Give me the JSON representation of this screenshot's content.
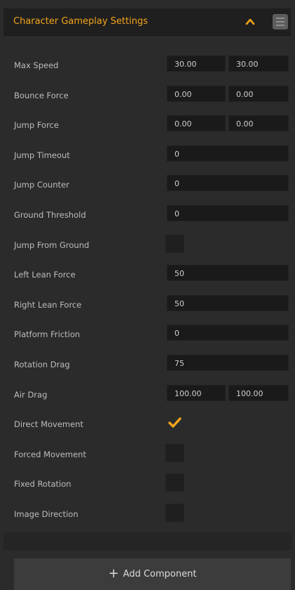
{
  "header": {
    "title": "Character Gameplay Settings",
    "collapse_icon": "chevron-up-icon",
    "menu_icon": "menu-icon",
    "accent": "#f3a51b"
  },
  "rows": [
    {
      "id": "max-speed",
      "label": "Max Speed",
      "type": "vec2",
      "values": [
        "30.00",
        "30.00"
      ]
    },
    {
      "id": "bounce-force",
      "label": "Bounce Force",
      "type": "vec2",
      "values": [
        "0.00",
        "0.00"
      ]
    },
    {
      "id": "jump-force",
      "label": "Jump Force",
      "type": "vec2",
      "values": [
        "0.00",
        "0.00"
      ]
    },
    {
      "id": "jump-timeout",
      "label": "Jump Timeout",
      "type": "number",
      "value": "0"
    },
    {
      "id": "jump-counter",
      "label": "Jump Counter",
      "type": "number",
      "value": "0"
    },
    {
      "id": "ground-threshold",
      "label": "Ground Threshold",
      "type": "number",
      "value": "0"
    },
    {
      "id": "jump-from-ground",
      "label": "Jump From Ground",
      "type": "bool",
      "checked": false
    },
    {
      "id": "left-lean-force",
      "label": "Left Lean Force",
      "type": "number",
      "value": "50"
    },
    {
      "id": "right-lean-force",
      "label": "Right Lean Force",
      "type": "number",
      "value": "50"
    },
    {
      "id": "platform-friction",
      "label": "Platform Friction",
      "type": "number",
      "value": "0"
    },
    {
      "id": "rotation-drag",
      "label": "Rotation Drag",
      "type": "number",
      "value": "75"
    },
    {
      "id": "air-drag",
      "label": "Air Drag",
      "type": "vec2",
      "values": [
        "100.00",
        "100.00"
      ]
    },
    {
      "id": "direct-movement",
      "label": "Direct Movement",
      "type": "bool",
      "checked": true
    },
    {
      "id": "forced-movement",
      "label": "Forced Movement",
      "type": "bool",
      "checked": false
    },
    {
      "id": "fixed-rotation",
      "label": "Fixed Rotation",
      "type": "bool",
      "checked": false
    },
    {
      "id": "image-direction",
      "label": "Image Direction",
      "type": "bool",
      "checked": false
    }
  ],
  "footer": {
    "add_component_label": "Add Component",
    "add_icon": "plus-icon"
  }
}
